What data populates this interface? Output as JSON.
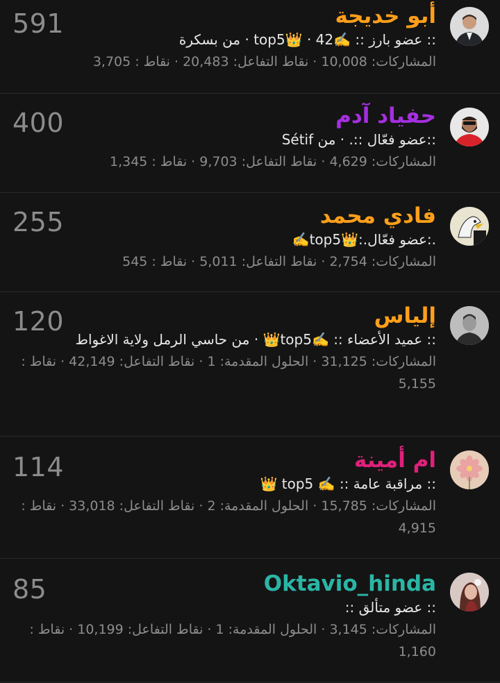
{
  "members": [
    {
      "name": "أبو خديجة",
      "name_color": "#ff9f1a",
      "score": "591",
      "info": ":: عضو بارز :: ✍️top5👑 · 42 · من بسكرة",
      "stats": "المشاركات: 10,008 · نقاط التفاعل: 20,483 · نقاط : 3,705",
      "avatar_icon": "man-in-suit-avatar"
    },
    {
      "name": "حفياد آدم",
      "name_color": "#a52fe0",
      "score": "400",
      "info": "::عضو فعّال ::. · من Sétif",
      "stats": "المشاركات: 4,629 · نقاط التفاعل: 9,703 · نقاط : 1,345",
      "avatar_icon": "bearded-man-avatar"
    },
    {
      "name": "فادي محمد",
      "name_color": "#ff9f1a",
      "score": "255",
      "info": ".:عضو فعّال.:👑top5✍️",
      "stats": "المشاركات: 2,754 · نقاط التفاعل: 5,011 · نقاط : 545",
      "avatar_icon": "eagle-avatar"
    },
    {
      "name": "إلياس",
      "name_color": "#ff9f1a",
      "score": "120",
      "info": ":: عميد الأعضاء :: ✍️top5👑 · من حاسي الرمل ولاية الاغواط",
      "stats": "المشاركات: 31,125 · الحلول المقدمة: 1 · نقاط التفاعل: 42,149 · نقاط : 5,155",
      "avatar_icon": "man-portrait-avatar"
    },
    {
      "name": "ام أمينة",
      "name_color": "#e0207a",
      "score": "114",
      "info": ":: مراقبة عامة :: ✍️ top5 👑",
      "stats": "المشاركات: 15,785 · الحلول المقدمة: 2 · نقاط التفاعل: 33,018 · نقاط : 4,915",
      "avatar_icon": "flower-avatar"
    },
    {
      "name": "Oktavio_hinda",
      "name_color": "#2bb5a5",
      "score": "85",
      "info": ":: عضو متألق ::",
      "stats": "المشاركات: 3,145 · الحلول المقدمة: 1 · نقاط التفاعل: 10,199 · نقاط : 1,160",
      "avatar_icon": "woman-avatar"
    }
  ]
}
